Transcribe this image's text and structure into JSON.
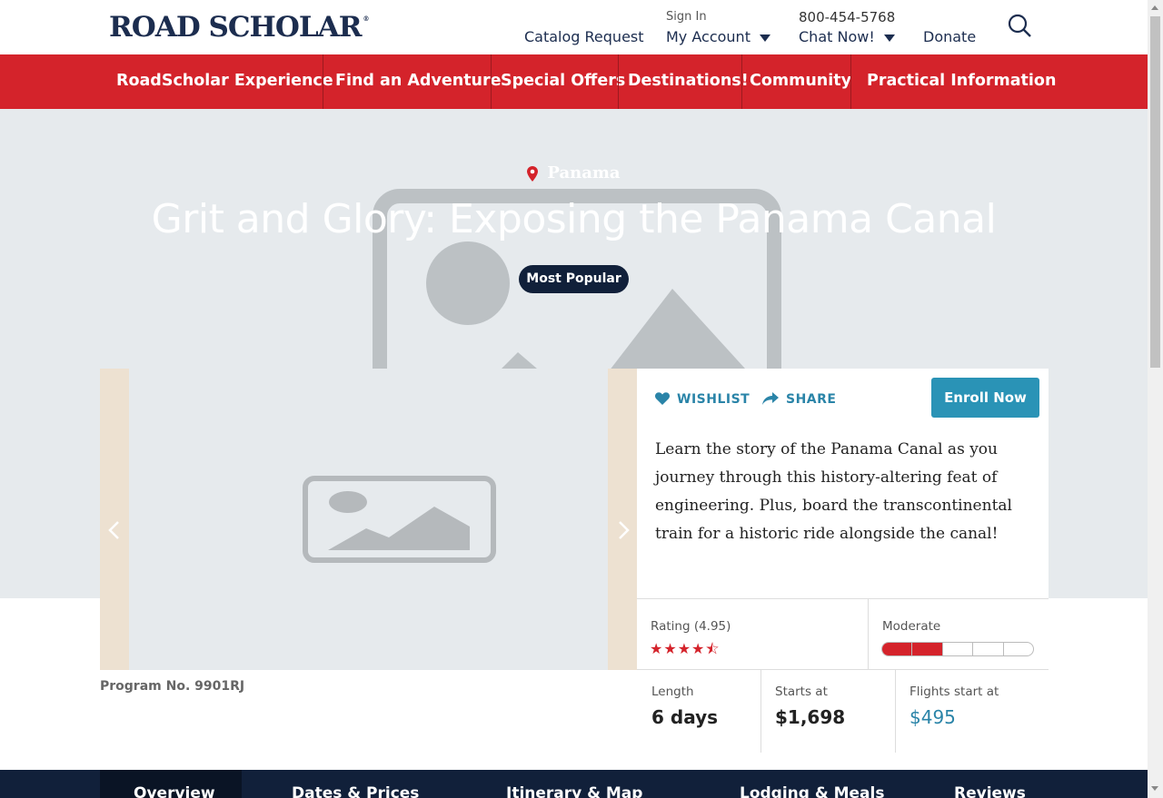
{
  "header": {
    "logo": "ROAD SCHOLAR",
    "logo_mark": "®",
    "catalog_request": "Catalog Request",
    "sign_in": "Sign In",
    "my_account": "My Account",
    "phone": "800-454-5768",
    "chat_now": "Chat Now!",
    "donate": "Donate",
    "search_icon": "search-icon"
  },
  "nav": {
    "items": [
      {
        "label": "RoadScholar Experience"
      },
      {
        "label": "Find an Adventure"
      },
      {
        "label": "Special Offers"
      },
      {
        "label": "Destinations!"
      },
      {
        "label": "Community"
      },
      {
        "label": "Practical Information"
      }
    ],
    "color": "#d4232b"
  },
  "hero": {
    "location": "Panama",
    "title": "Grit and Glory: Exposing the Panama Canal",
    "badge": "Most Popular"
  },
  "program": {
    "number_label": "Program No. 9901RJ",
    "wishlist": "WISHLIST",
    "share": "SHARE",
    "enroll": "Enroll Now",
    "description": "Learn the story of the Panama Canal as you journey through this history-altering feat of engineering. Plus, board the transcontinental train for a historic ride alongside the canal!",
    "rating_label": "Rating (4.95)",
    "rating_value": 4.95,
    "activity_label": "Moderate",
    "activity_level": 2,
    "activity_max": 5,
    "length_label": "Length",
    "length_value": "6 days",
    "starts_label": "Starts at",
    "starts_value": "$1,698",
    "flights_label": "Flights start at",
    "flights_value": "$495"
  },
  "tabs": [
    {
      "label": "Overview",
      "active": true
    },
    {
      "label": "Dates & Prices"
    },
    {
      "label": "Itinerary & Map"
    },
    {
      "label": "Lodging & Meals"
    },
    {
      "label": "Reviews"
    }
  ],
  "colors": {
    "brand_red": "#d4232b",
    "navy": "#11203a",
    "link_blue": "#2a84a8"
  }
}
